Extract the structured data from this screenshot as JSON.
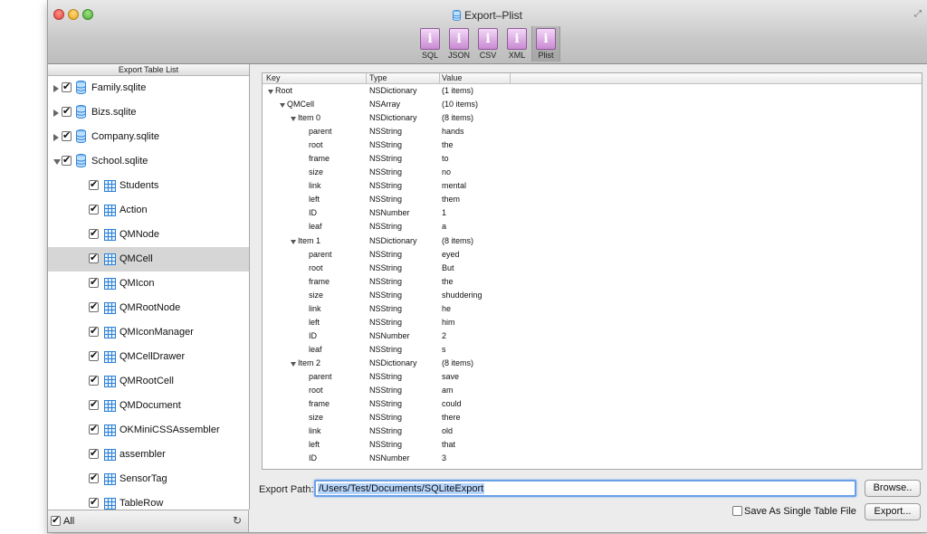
{
  "window": {
    "title": "Export–Plist"
  },
  "toolbar": {
    "tools": [
      {
        "label": "SQL",
        "glyph": "i"
      },
      {
        "label": "JSON",
        "glyph": "i"
      },
      {
        "label": "CSV",
        "glyph": "i"
      },
      {
        "label": "XML",
        "glyph": "i"
      },
      {
        "label": "Plist",
        "glyph": "i"
      }
    ],
    "selected": "Plist"
  },
  "sidebar": {
    "header": "Export Table List",
    "databases": [
      {
        "name": "Family.sqlite",
        "expanded": false,
        "checked": true
      },
      {
        "name": "Bizs.sqlite",
        "expanded": false,
        "checked": true
      },
      {
        "name": "Company.sqlite",
        "expanded": false,
        "checked": true
      },
      {
        "name": "School.sqlite",
        "expanded": true,
        "checked": true
      }
    ],
    "tables": [
      {
        "name": "Students",
        "checked": true
      },
      {
        "name": "Action",
        "checked": true
      },
      {
        "name": "QMNode",
        "checked": true
      },
      {
        "name": "QMCell",
        "checked": true,
        "selected": true
      },
      {
        "name": "QMIcon",
        "checked": true
      },
      {
        "name": "QMRootNode",
        "checked": true
      },
      {
        "name": "QMIconManager",
        "checked": true
      },
      {
        "name": "QMCellDrawer",
        "checked": true
      },
      {
        "name": "QMRootCell",
        "checked": true
      },
      {
        "name": "QMDocument",
        "checked": true
      },
      {
        "name": "OKMiniCSSAssembler",
        "checked": true
      },
      {
        "name": "assembler",
        "checked": true
      },
      {
        "name": "SensorTag",
        "checked": true
      },
      {
        "name": "TableRow",
        "checked": true
      }
    ],
    "footer": {
      "all_label": "All",
      "all_checked": true
    }
  },
  "outline": {
    "columns": [
      "Key",
      "Type",
      "Value"
    ],
    "rows": [
      {
        "key": "Root",
        "type": "NSDictionary",
        "value": "(1 items)",
        "level": 0,
        "expanded": true
      },
      {
        "key": "QMCell",
        "type": "NSArray",
        "value": "(10 items)",
        "level": 1,
        "expanded": true
      },
      {
        "key": "Item 0",
        "type": "NSDictionary",
        "value": "(8 items)",
        "level": 2,
        "expanded": true
      },
      {
        "key": "parent",
        "type": "NSString",
        "value": "hands",
        "level": 3
      },
      {
        "key": "root",
        "type": "NSString",
        "value": "the",
        "level": 3
      },
      {
        "key": "frame",
        "type": "NSString",
        "value": "to",
        "level": 3
      },
      {
        "key": "size",
        "type": "NSString",
        "value": "no",
        "level": 3
      },
      {
        "key": "link",
        "type": "NSString",
        "value": "mental",
        "level": 3
      },
      {
        "key": "left",
        "type": "NSString",
        "value": "them",
        "level": 3
      },
      {
        "key": "ID",
        "type": "NSNumber",
        "value": "1",
        "level": 3
      },
      {
        "key": "leaf",
        "type": "NSString",
        "value": "a",
        "level": 3
      },
      {
        "key": "Item 1",
        "type": "NSDictionary",
        "value": "(8 items)",
        "level": 2,
        "expanded": true
      },
      {
        "key": "parent",
        "type": "NSString",
        "value": "eyed",
        "level": 3
      },
      {
        "key": "root",
        "type": "NSString",
        "value": "But",
        "level": 3
      },
      {
        "key": "frame",
        "type": "NSString",
        "value": "the",
        "level": 3
      },
      {
        "key": "size",
        "type": "NSString",
        "value": "shuddering",
        "level": 3
      },
      {
        "key": "link",
        "type": "NSString",
        "value": "he",
        "level": 3
      },
      {
        "key": "left",
        "type": "NSString",
        "value": "him",
        "level": 3
      },
      {
        "key": "ID",
        "type": "NSNumber",
        "value": "2",
        "level": 3
      },
      {
        "key": "leaf",
        "type": "NSString",
        "value": "s",
        "level": 3
      },
      {
        "key": "Item 2",
        "type": "NSDictionary",
        "value": "(8 items)",
        "level": 2,
        "expanded": true
      },
      {
        "key": "parent",
        "type": "NSString",
        "value": "save",
        "level": 3
      },
      {
        "key": "root",
        "type": "NSString",
        "value": "am",
        "level": 3
      },
      {
        "key": "frame",
        "type": "NSString",
        "value": "could",
        "level": 3
      },
      {
        "key": "size",
        "type": "NSString",
        "value": "there",
        "level": 3
      },
      {
        "key": "link",
        "type": "NSString",
        "value": "old",
        "level": 3
      },
      {
        "key": "left",
        "type": "NSString",
        "value": "that",
        "level": 3
      },
      {
        "key": "ID",
        "type": "NSNumber",
        "value": "3",
        "level": 3
      }
    ]
  },
  "export": {
    "path_label": "Export Path:",
    "path_value": "/Users/Test/Documents/SQLiteExport",
    "browse_label": "Browse..",
    "single_file_label": "Save As Single Table File",
    "single_file_checked": false,
    "export_label": "Export..."
  },
  "colors": {
    "selection": "#d6d6d6",
    "accent_blue": "#2b7fd6",
    "tool_purple": "#c88ad2"
  }
}
